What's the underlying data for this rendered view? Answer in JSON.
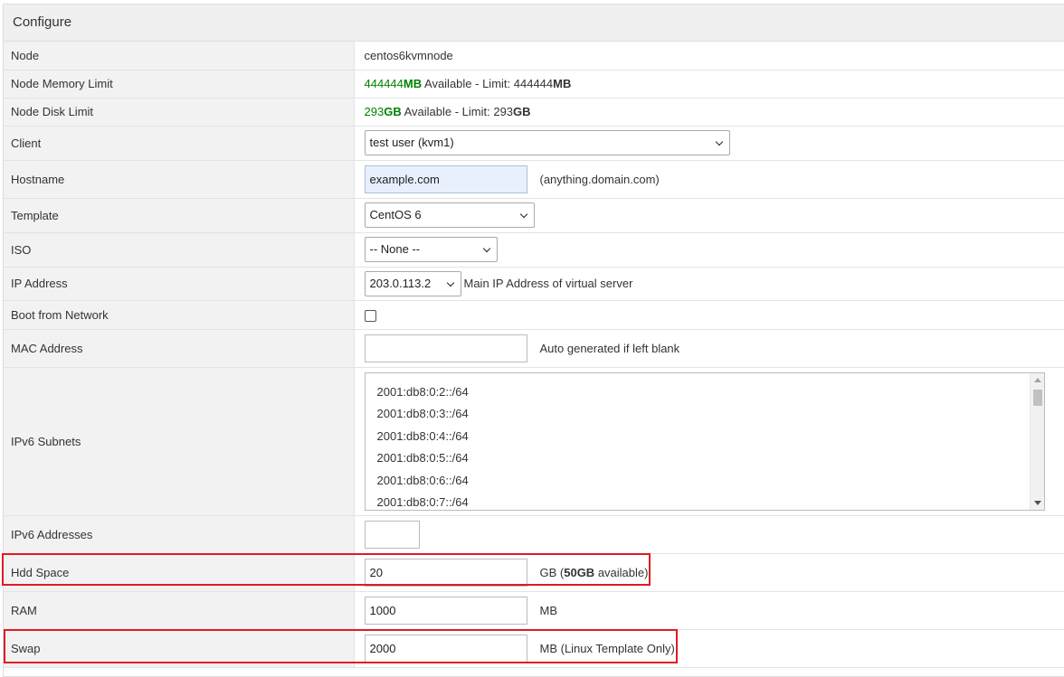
{
  "panel": {
    "title": "Configure"
  },
  "rows": {
    "node": {
      "label": "Node",
      "value": "centos6kvmnode"
    },
    "memory": {
      "label": "Node Memory Limit",
      "available_num": "444444",
      "unit": "MB",
      "available_text": " Available - Limit: ",
      "limit_num": "444444",
      "limit_unit": "MB"
    },
    "disk": {
      "label": "Node Disk Limit",
      "available_num": "293",
      "unit": "GB",
      "available_text": " Available - Limit: ",
      "limit_num": "293",
      "limit_unit": "GB"
    },
    "client": {
      "label": "Client",
      "selected": "test user (kvm1)"
    },
    "hostname": {
      "label": "Hostname",
      "value": "example.com",
      "hint": "(anything.domain.com)"
    },
    "template": {
      "label": "Template",
      "selected": "CentOS 6"
    },
    "iso": {
      "label": "ISO",
      "selected": "-- None --"
    },
    "ip": {
      "label": "IP Address",
      "selected": "203.0.113.2",
      "hint": "Main IP Address of virtual server"
    },
    "boot": {
      "label": "Boot from Network"
    },
    "mac": {
      "label": "MAC Address",
      "value": "",
      "hint": "Auto generated if left blank"
    },
    "ipv6_subnets": {
      "label": "IPv6 Subnets",
      "options": [
        "2001:db8:0:2::/64",
        "2001:db8:0:3::/64",
        "2001:db8:0:4::/64",
        "2001:db8:0:5::/64",
        "2001:db8:0:6::/64",
        "2001:db8:0:7::/64"
      ]
    },
    "ipv6_addresses": {
      "label": "IPv6 Addresses",
      "value": ""
    },
    "hdd": {
      "label": "Hdd Space",
      "value": "20",
      "hint_pre": "GB (",
      "hint_bold": "50GB",
      "hint_post": " available)"
    },
    "ram": {
      "label": "RAM",
      "value": "1000",
      "hint": "MB"
    },
    "swap": {
      "label": "Swap",
      "value": "2000",
      "hint": "MB (Linux Template Only)"
    }
  },
  "colors": {
    "available_green": "#008000",
    "highlight_red": "#e01b24",
    "label_bg": "#f2f2f2"
  },
  "icons": {
    "select_chevron": "chevron-down-icon",
    "scroll_up": "scroll-up-arrow-icon",
    "scroll_down": "scroll-down-arrow-icon"
  }
}
